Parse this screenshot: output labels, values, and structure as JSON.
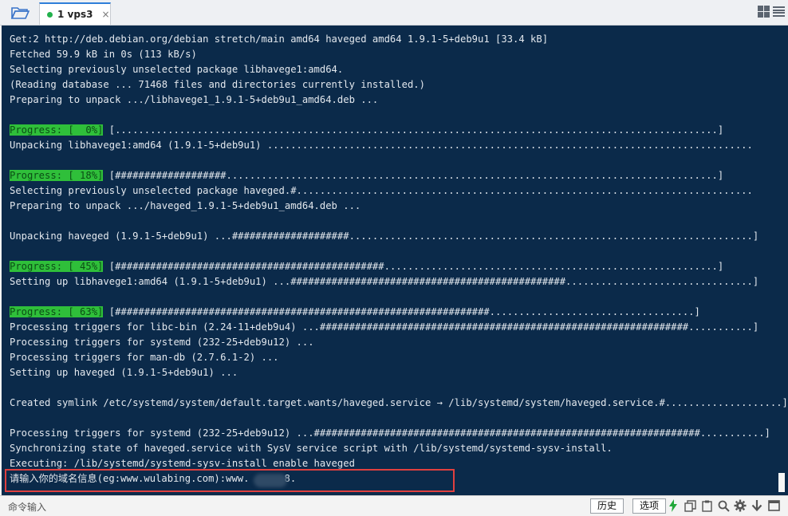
{
  "tab": {
    "title": "1 vps3",
    "close": "×"
  },
  "terminal": {
    "lines": [
      "Get:2 http://deb.debian.org/debian stretch/main amd64 haveged amd64 1.9.1-5+deb9u1 [33.4 kB]",
      "Fetched 59.9 kB in 0s (113 kB/s)",
      "Selecting previously unselected package libhavege1:amd64.",
      "(Reading database ... 71468 files and directories currently installed.)",
      "Preparing to unpack .../libhavege1_1.9.1-5+deb9u1_amd64.deb ...",
      "",
      "|Progress: [  0%]| [.......................................................................................................]",
      "Unpacking libhavege1:amd64 (1.9.1-5+deb9u1) ...................................................................................",
      "",
      "|Progress: [ 18%]| [###################....................................................................................]",
      "Selecting previously unselected package haveged.#..............................................................................",
      "Preparing to unpack .../haveged_1.9.1-5+deb9u1_amd64.deb ...",
      "",
      "Unpacking haveged (1.9.1-5+deb9u1) ...####################.....................................................................]",
      "",
      "|Progress: [ 45%]| [##############################################.........................................................]",
      "Setting up libhavege1:amd64 (1.9.1-5+deb9u1) ...###############################################................................]",
      "",
      "|Progress: [ 63%]| [################################################################...................................]",
      "Processing triggers for libc-bin (2.24-11+deb9u4) ...###############################################################...........]",
      "Processing triggers for systemd (232-25+deb9u12) ...",
      "Processing triggers for man-db (2.7.6.1-2) ...",
      "Setting up haveged (1.9.1-5+deb9u1) ...",
      "",
      "Created symlink /etc/systemd/system/default.target.wants/haveged.service → /lib/systemd/system/haveged.service.#....................]",
      "",
      "Processing triggers for systemd (232-25+deb9u12) ...##################################################################...........]",
      "Synchronizing state of haveged.service with SysV service script with /lib/systemd/systemd-sysv-install.",
      "Executing: /lib/systemd/systemd-sysv-install enable haveged",
      "请输入你的域名信息(eg:www.wulabing.com):www.      8."
    ]
  },
  "bottom": {
    "cmd_placeholder": "命令输入",
    "history_label": "历史",
    "options_label": "选项"
  },
  "icons": [
    "folder-icon",
    "grid-layout-icon",
    "menu-icon",
    "lightning-icon",
    "copy-icon",
    "paste-icon",
    "search-icon",
    "gear-icon",
    "download-icon",
    "window-icon"
  ],
  "colors": {
    "terminal_bg": "#0b2a4a",
    "progress_bg": "#2fbf3a",
    "highlight": "#e0403f",
    "tab_accent": "#2f7fd9"
  }
}
